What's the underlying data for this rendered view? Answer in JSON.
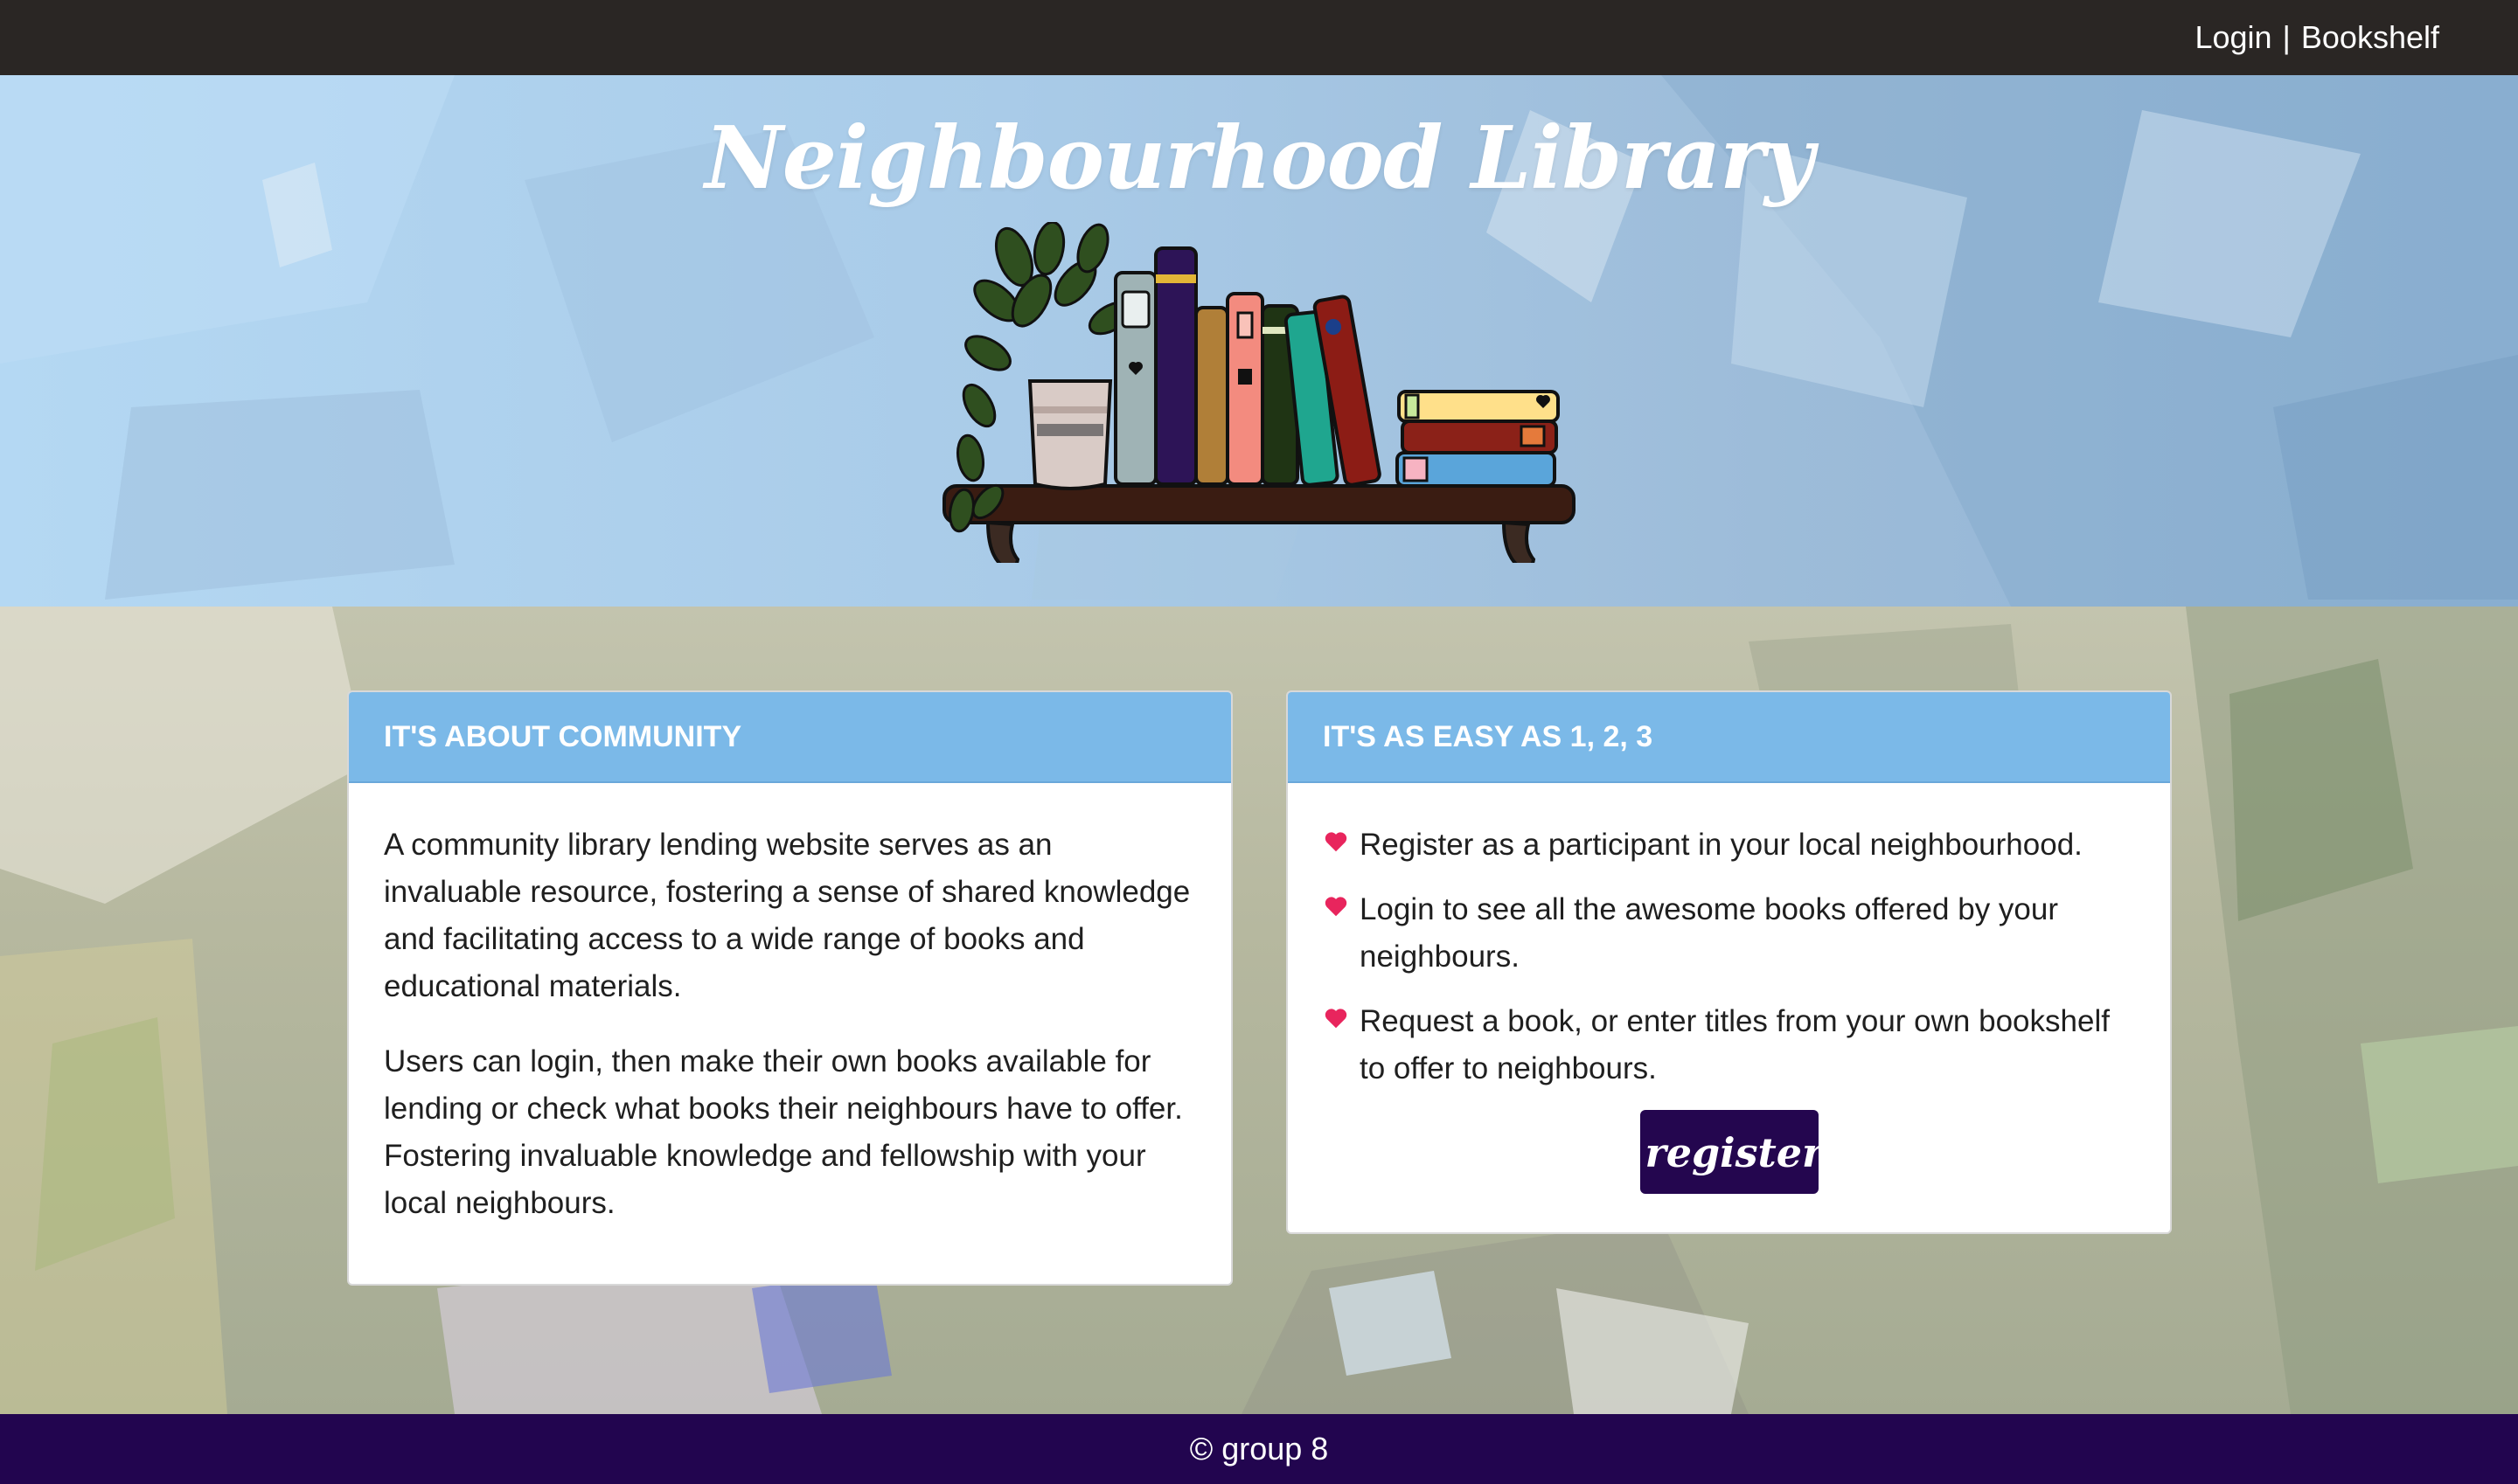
{
  "nav": {
    "login": "Login",
    "separator": "|",
    "bookshelf": "Bookshelf"
  },
  "hero": {
    "title": "Neighbourhood Library",
    "illustration": "bookshelf-with-plant"
  },
  "about_card": {
    "heading": "IT'S ABOUT COMMUNITY",
    "paragraphs": [
      "A community library lending website serves as an invaluable resource, fostering a sense of shared knowledge and facilitating access to a wide range of books and educational materials.",
      "Users can login, then make their own books available for lending or check what books their neighbours have to offer. Fostering invaluable knowledge and fellowship with your local neighbours."
    ]
  },
  "steps_card": {
    "heading": "IT'S AS EASY AS 1, 2, 3",
    "bullet_icon": "heart-icon",
    "steps": [
      "Register as a participant in your local neighbourhood.",
      "Login to see all the awesome books offered by your neighbours.",
      "Request a book, or enter titles from your own bookshelf to offer to neighbours."
    ],
    "register_label": "register"
  },
  "footer": {
    "text": "© group 8"
  },
  "colors": {
    "topbar": "#2a2624",
    "card_header": "#7bb9e8",
    "register_button": "#24064f",
    "footer": "#22054f",
    "heart": "#e8255d"
  }
}
